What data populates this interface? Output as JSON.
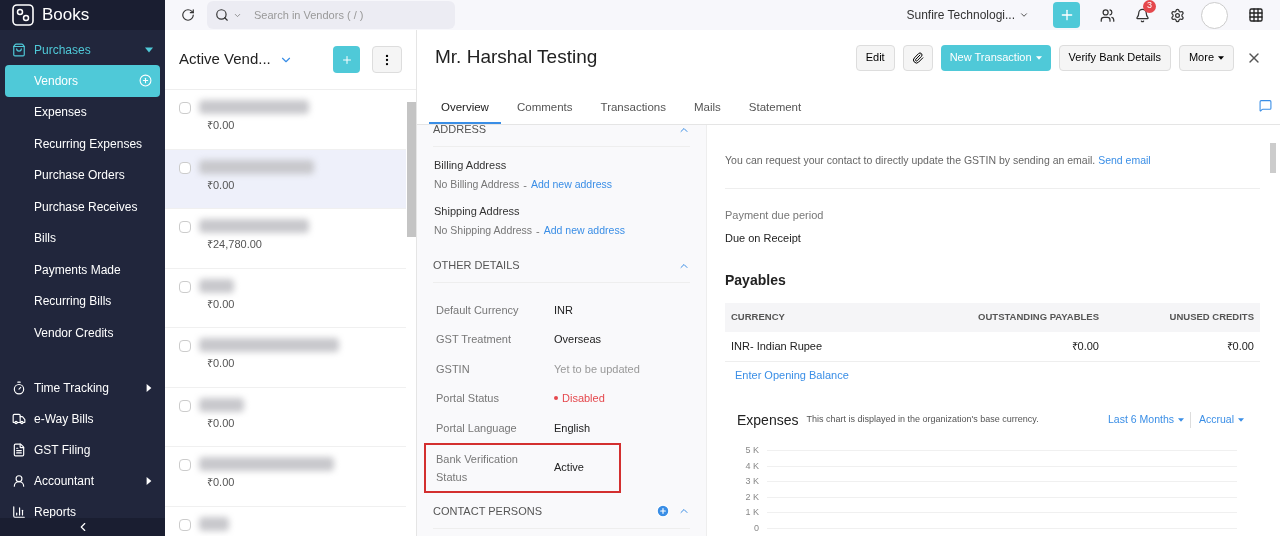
{
  "app": {
    "name": "Books"
  },
  "sidebar": {
    "items": [
      {
        "label": "Purchases",
        "expanded": true,
        "children": [
          {
            "label": "Vendors",
            "selected": true
          },
          {
            "label": "Expenses",
            "selected": false
          },
          {
            "label": "Recurring Expenses",
            "selected": false
          },
          {
            "label": "Purchase Orders",
            "selected": false
          },
          {
            "label": "Purchase Receives",
            "selected": false
          },
          {
            "label": "Bills",
            "selected": false
          },
          {
            "label": "Payments Made",
            "selected": false
          },
          {
            "label": "Recurring Bills",
            "selected": false
          },
          {
            "label": "Vendor Credits",
            "selected": false
          }
        ]
      },
      {
        "label": "Time Tracking",
        "expanded": false
      },
      {
        "label": "e-Way Bills"
      },
      {
        "label": "GST Filing"
      },
      {
        "label": "Accountant",
        "expanded": false
      },
      {
        "label": "Reports"
      }
    ]
  },
  "topbar": {
    "search_placeholder": "Search in Vendors ( / )",
    "organization": "Sunfire Technologi...",
    "notification_count": "3"
  },
  "list": {
    "title": "Active Vend...",
    "rows": [
      {
        "amount": "₹0.00",
        "selected": false,
        "checked": false
      },
      {
        "amount": "₹0.00",
        "selected": true,
        "checked": false
      },
      {
        "amount": "₹24,780.00",
        "selected": false,
        "checked": false
      },
      {
        "amount": "₹0.00",
        "selected": false,
        "checked": false
      },
      {
        "amount": "₹0.00",
        "selected": false,
        "checked": false
      },
      {
        "amount": "₹0.00",
        "selected": false,
        "checked": false
      },
      {
        "amount": "₹0.00",
        "selected": false,
        "checked": false
      },
      {
        "selected": false,
        "checked": false
      }
    ]
  },
  "detail": {
    "title": "Mr. Harshal Testing",
    "actions": [
      {
        "label": "Edit",
        "kind": "plain"
      },
      {
        "kind": "attach"
      },
      {
        "label": "New Transaction",
        "kind": "primary"
      },
      {
        "label": "Verify Bank Details",
        "kind": "plain"
      },
      {
        "label": "More",
        "kind": "menu"
      }
    ],
    "tabs": [
      {
        "label": "Overview",
        "selected": true
      },
      {
        "label": "Comments",
        "selected": false
      },
      {
        "label": "Transactions",
        "selected": false
      },
      {
        "label": "Mails",
        "selected": false
      },
      {
        "label": "Statement",
        "selected": false
      }
    ],
    "address": {
      "heading": "ADDRESS",
      "blocks": [
        {
          "label": "Billing Address",
          "value": "No Billing Address",
          "separator": "-",
          "link": "Add new address"
        },
        {
          "label": "Shipping Address",
          "value": "No Shipping Address",
          "separator": "-",
          "link": "Add new address"
        }
      ]
    },
    "other_details": {
      "heading": "OTHER DETAILS",
      "fields": [
        {
          "label": "Default Currency",
          "value": "INR",
          "kind": "text"
        },
        {
          "label": "GST Treatment",
          "value": "Overseas",
          "kind": "text"
        },
        {
          "label": "GSTIN",
          "value": "Yet to be updated",
          "kind": "muted"
        },
        {
          "label": "Portal Status",
          "value": "Disabled",
          "kind": "status",
          "color": "#e5484d"
        },
        {
          "label": "Portal Language",
          "value": "English",
          "kind": "text"
        },
        {
          "label": "Bank Verification Status",
          "value": "Active",
          "kind": "text",
          "highlighted": true
        }
      ]
    },
    "contact_persons": {
      "heading": "CONTACT PERSONS"
    },
    "gstin_note": {
      "text": "You can request your contact to directly update the GSTIN by sending an email.",
      "link": "Send email"
    },
    "payment_due": {
      "label": "Payment due period",
      "value": "Due on Receipt"
    },
    "payables": {
      "heading": "Payables",
      "columns": [
        "CURRENCY",
        "OUTSTANDING PAYABLES",
        "UNUSED CREDITS"
      ],
      "rows": [
        [
          "INR- Indian Rupee",
          "₹0.00",
          "₹0.00"
        ]
      ],
      "link": "Enter Opening Balance"
    },
    "expenses": {
      "title": "Expenses",
      "note": "This chart is displayed in the organization's base currency.",
      "period": "Last 6 Months",
      "basis": "Accrual",
      "y_axis_labels": [
        "5 K",
        "4 K",
        "3 K",
        "2 K",
        "1 K",
        "0"
      ]
    }
  }
}
